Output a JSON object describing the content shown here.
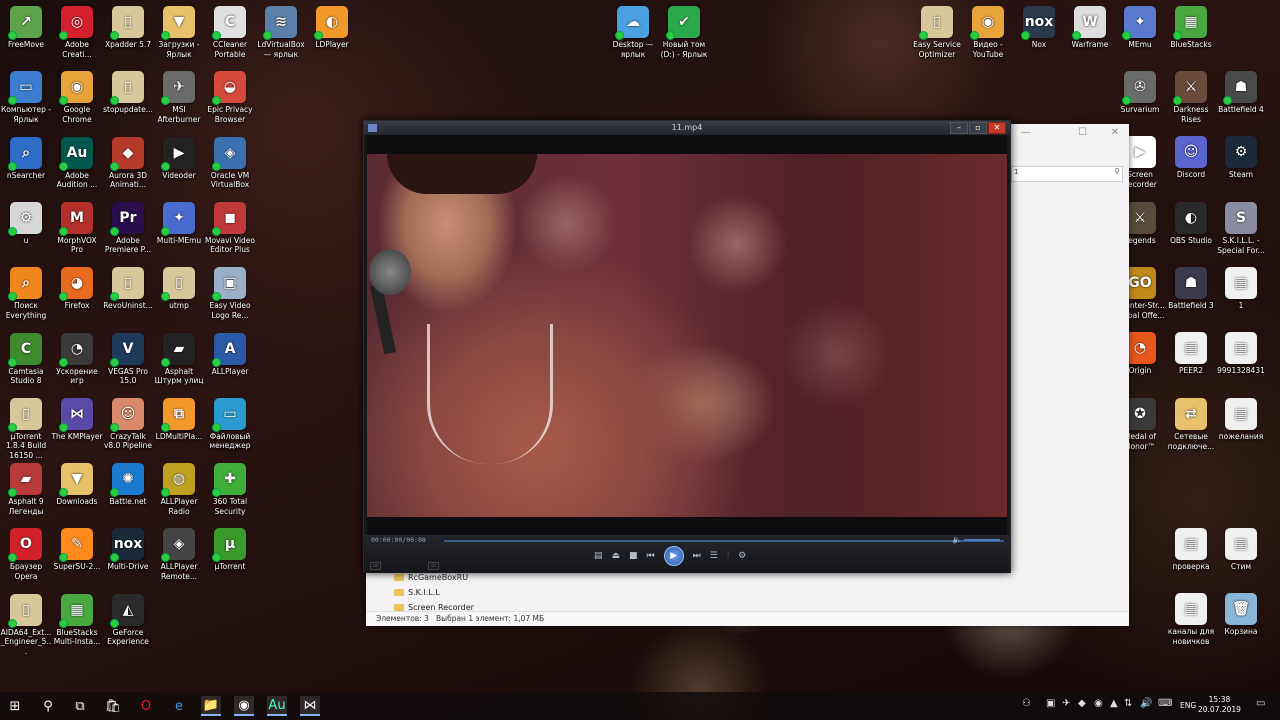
{
  "desktop": {
    "left_icons": [
      {
        "label": "FreeMove",
        "color": "#5da34a",
        "glyph": "↗"
      },
      {
        "label": "Adobe Creati...",
        "color": "#d4202c",
        "glyph": "◎"
      },
      {
        "label": "Xpadder 5.7",
        "color": "#d8c79a",
        "glyph": "▯"
      },
      {
        "label": "Загрузки - Ярлык",
        "color": "#e7c26a",
        "glyph": "▼"
      },
      {
        "label": "CCleaner Portable",
        "color": "#e0e0e0",
        "glyph": "C"
      },
      {
        "label": "LdVirtualBox — ярлык",
        "color": "#5a7fa8",
        "glyph": "≋"
      },
      {
        "label": "LDPlayer",
        "color": "#f19a2b",
        "glyph": "◐"
      },
      {
        "label": "Компьютер - Ярлык",
        "color": "#3d7dd0",
        "glyph": "▭"
      },
      {
        "label": "Google Chrome",
        "color": "#e8a33a",
        "glyph": "◉"
      },
      {
        "label": "stopupdate...",
        "color": "#d8c79a",
        "glyph": "▯"
      },
      {
        "label": "MSI Afterburner",
        "color": "#6a6a6a",
        "glyph": "✈"
      },
      {
        "label": "Epic Privacy Browser",
        "color": "#d64a3c",
        "glyph": "◒"
      },
      {
        "label": "nSearcher",
        "color": "#2d6cc7",
        "glyph": "⌕"
      },
      {
        "label": "Adobe Audition ...",
        "color": "#00584f",
        "glyph": "Au"
      },
      {
        "label": "Aurora 3D Animati...",
        "color": "#b53a2a",
        "glyph": "◆"
      },
      {
        "label": "Videoder",
        "color": "#222222",
        "glyph": "▶"
      },
      {
        "label": "Oracle VM VirtualBox",
        "color": "#3a6fb0",
        "glyph": "◈"
      },
      {
        "label": "u",
        "color": "#d7d7d7",
        "glyph": "⚙"
      },
      {
        "label": "MorphVOX Pro",
        "color": "#b4302a",
        "glyph": "M"
      },
      {
        "label": "Adobe Premiere P...",
        "color": "#2a0d4a",
        "glyph": "Pr"
      },
      {
        "label": "Multi-MEmu",
        "color": "#4a6bd0",
        "glyph": "✦"
      },
      {
        "label": "Movavi Video Editor Plus",
        "color": "#c13a3a",
        "glyph": "◼"
      },
      {
        "label": "Поиск Everything",
        "color": "#f0871c",
        "glyph": "⌕"
      },
      {
        "label": "Firefox",
        "color": "#e86a1c",
        "glyph": "◕"
      },
      {
        "label": "RevoUninst...",
        "color": "#d8c79a",
        "glyph": "▯"
      },
      {
        "label": "utmp",
        "color": "#d8c79a",
        "glyph": "▯"
      },
      {
        "label": "Easy Video Logo Re...",
        "color": "#9ab0c8",
        "glyph": "▣"
      },
      {
        "label": "Camtasia Studio 8",
        "color": "#3e8a2e",
        "glyph": "C"
      },
      {
        "label": "Ускорение игр",
        "color": "#3a3a3a",
        "glyph": "◔"
      },
      {
        "label": "VEGAS Pro 15.0",
        "color": "#1d3a5a",
        "glyph": "V"
      },
      {
        "label": "Asphalt Штурм улиц",
        "color": "#222222",
        "glyph": "▰"
      },
      {
        "label": "ALLPlayer",
        "color": "#2a5aa8",
        "glyph": "A"
      },
      {
        "label": "µTorrent 1.8.4 Build 16150 ...",
        "color": "#d8c79a",
        "glyph": "▯"
      },
      {
        "label": "The KMPlayer",
        "color": "#5a4aa8",
        "glyph": "⋈"
      },
      {
        "label": "CrazyTalk v8.0 Pipeline",
        "color": "#d88a6a",
        "glyph": "☺"
      },
      {
        "label": "LDMultiPla...",
        "color": "#f19a2b",
        "glyph": "⧉"
      },
      {
        "label": "Файловый менеджер",
        "color": "#2a9ad0",
        "glyph": "▭"
      },
      {
        "label": "Asphalt 9 Легенды",
        "color": "#b83a3a",
        "glyph": "▰"
      },
      {
        "label": "Downloads",
        "color": "#e7c26a",
        "glyph": "▼"
      },
      {
        "label": "Battle.net",
        "color": "#1a7ad0",
        "glyph": "✺"
      },
      {
        "label": "ALLPlayer Radio",
        "color": "#c0a020",
        "glyph": "◍"
      },
      {
        "label": "360 Total Security",
        "color": "#3fae3a",
        "glyph": "✚"
      },
      {
        "label": "Браузер Opera",
        "color": "#d0202a",
        "glyph": "O"
      },
      {
        "label": "SuperSU-2...",
        "color": "#ff8a1c",
        "glyph": "✎"
      },
      {
        "label": "Multi-Drive",
        "color": "#1a2a3a",
        "glyph": "nox"
      },
      {
        "label": "ALLPlayer Remote...",
        "color": "#444444",
        "glyph": "◈"
      },
      {
        "label": "µTorrent",
        "color": "#3a9a2a",
        "glyph": "µ"
      },
      {
        "label": "AIDA64_Ext... _Engineer_5...",
        "color": "#d8c79a",
        "glyph": "▯"
      },
      {
        "label": "BlueStacks Multi-Insta...",
        "color": "#4aa840",
        "glyph": "▦"
      },
      {
        "label": "GeForce Experience",
        "color": "#2a2a2a",
        "glyph": "◭"
      }
    ],
    "top_center_icons": [
      {
        "label": "Desktop — ярлык",
        "color": "#4aa0e0",
        "glyph": "☁"
      },
      {
        "label": "Новый том (D:) - Ярлык",
        "color": "#2aa84a",
        "glyph": "✔"
      }
    ],
    "right_icons": [
      {
        "label": "Easy Service Optimizer",
        "color": "#d8c79a",
        "glyph": "▯"
      },
      {
        "label": "Видео - YouTube",
        "color": "#e8a33a",
        "glyph": "◉"
      },
      {
        "label": "Nox",
        "color": "#2a3a4a",
        "glyph": "nox"
      },
      {
        "label": "Warframe",
        "color": "#dddddd",
        "glyph": "W"
      },
      {
        "label": "MEmu",
        "color": "#5a7ad0",
        "glyph": "✦"
      },
      {
        "label": "BlueStacks",
        "color": "#4aa840",
        "glyph": "▦"
      },
      {
        "label": "Survarium",
        "color": "#6a6a6a",
        "glyph": "✇"
      },
      {
        "label": "Darkness Rises",
        "color": "#6a4a3a",
        "glyph": "⚔"
      },
      {
        "label": "Battlefield 4",
        "color": "#4a4a4a",
        "glyph": "☗"
      },
      {
        "label": "Screen Recorder",
        "color": "#ffffff",
        "glyph": "▶"
      },
      {
        "label": "Discord",
        "color": "#5a65d0",
        "glyph": "☺"
      },
      {
        "label": "Steam",
        "color": "#1a2a3a",
        "glyph": "⚙"
      },
      {
        "label": "Legends",
        "color": "#5a4a3a",
        "glyph": "⚔"
      },
      {
        "label": "OBS Studio",
        "color": "#2a2a2a",
        "glyph": "◐"
      },
      {
        "label": "S.K.I.L.L. - Special For...",
        "color": "#8a8aa0",
        "glyph": "S"
      },
      {
        "label": "Counter-Str... Global Offe...",
        "color": "#c08a1a",
        "glyph": "GO"
      },
      {
        "label": "Battlefield 3",
        "color": "#3a3a4a",
        "glyph": "☗"
      },
      {
        "label": "1",
        "color": "#f0f0f0",
        "glyph": "▤"
      },
      {
        "label": "Origin",
        "color": "#e8581c",
        "glyph": "◔"
      },
      {
        "label": "PEER2",
        "color": "#f0f0f0",
        "glyph": "▤"
      },
      {
        "label": "9991328431",
        "color": "#f0f0f0",
        "glyph": "▤"
      },
      {
        "label": "Medal of Honor™",
        "color": "#3a3a3a",
        "glyph": "✪"
      },
      {
        "label": "Сетевые подключе...",
        "color": "#e7c26a",
        "glyph": "⇄"
      },
      {
        "label": "пожелания",
        "color": "#f0f0f0",
        "glyph": "▤"
      },
      {
        "label": "проверка",
        "color": "#f0f0f0",
        "glyph": "▤"
      },
      {
        "label": "Стим",
        "color": "#f0f0f0",
        "glyph": "▤"
      },
      {
        "label": "каналы для новичков",
        "color": "#f0f0f0",
        "glyph": "▤"
      },
      {
        "label": "Корзина",
        "color": "#8ab4d8",
        "glyph": "🗑"
      }
    ]
  },
  "explorer": {
    "folders": [
      "RcGameBoxRU",
      "S.K.I.L.L",
      "Screen Recorder"
    ],
    "status_items": "Элементов: 3",
    "status_selected": "Выбран 1 элемент: 1,07 МБ",
    "search_value": "1"
  },
  "player": {
    "title": "11.mp4",
    "time": "00:00:00/00:08",
    "min_glyph": "–",
    "max_glyph": "▫",
    "close_glyph": "✕",
    "accent": "#2c5ba8"
  },
  "taskbar": {
    "lang": "ENG",
    "time": "15:38",
    "date": "20.07.2019",
    "apps": [
      "⊞",
      "⚲",
      "⧉",
      "🛍",
      "O",
      "e",
      "📁",
      "◉",
      "Au",
      "⋈"
    ]
  }
}
